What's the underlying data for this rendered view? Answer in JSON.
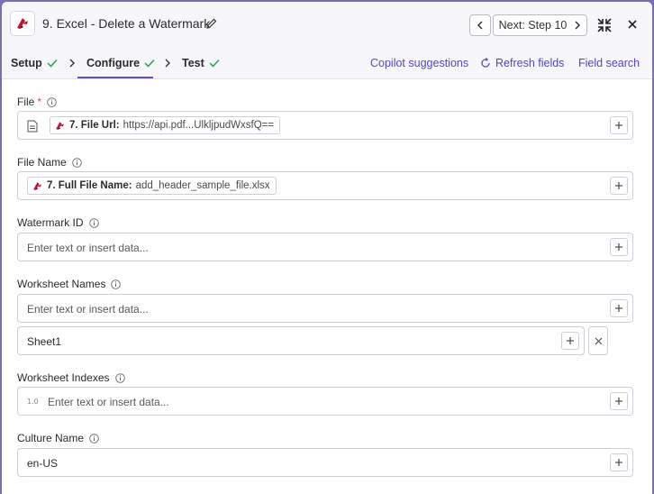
{
  "header": {
    "title": "9. Excel - Delete a Watermark",
    "next_label": "Next: Step 10",
    "icons": {
      "edit": "pencil-icon",
      "prev": "chevron-left-icon",
      "next": "chevron-right-icon",
      "collapse": "collapse-icon",
      "close": "close-icon"
    }
  },
  "tabs": [
    {
      "label": "Setup",
      "status": "check"
    },
    {
      "label": "Configure",
      "status": "check"
    },
    {
      "label": "Test",
      "status": "check"
    }
  ],
  "actions": {
    "copilot": "Copilot suggestions",
    "refresh": "Refresh fields",
    "field_search": "Field search"
  },
  "colors": {
    "accent": "#5b4fd1",
    "check": "#2e9e5a",
    "required": "#d9534f"
  },
  "fields": {
    "file": {
      "label": "File",
      "required_mark": "*",
      "pill_name": "7. File Url:",
      "pill_value": "https://api.pdf...UlkljpudWxsfQ=="
    },
    "file_name": {
      "label": "File Name",
      "pill_name": "7. Full File Name:",
      "pill_value": "add_header_sample_file.xlsx"
    },
    "watermark_id": {
      "label": "Watermark ID",
      "placeholder": "Enter text or insert data..."
    },
    "worksheet_names": {
      "label": "Worksheet Names",
      "placeholder": "Enter text or insert data...",
      "item_value": "Sheet1"
    },
    "worksheet_indexes": {
      "label": "Worksheet Indexes",
      "placeholder": "Enter text or insert data...",
      "type_badge": "1.0"
    },
    "culture_name": {
      "label": "Culture Name",
      "value": "en-US"
    }
  }
}
